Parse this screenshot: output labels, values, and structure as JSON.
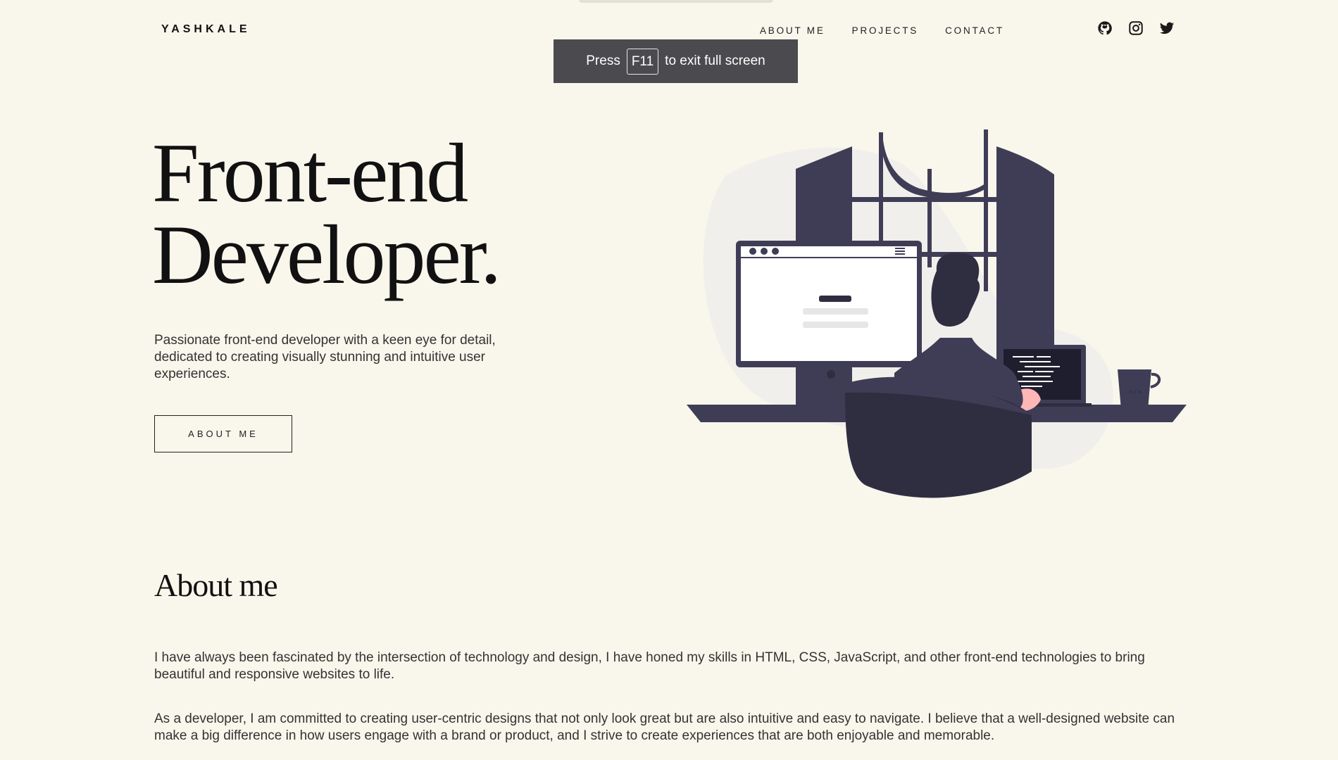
{
  "header": {
    "logo": "YASHKALE",
    "nav": [
      "ABOUT ME",
      "PROJECTS",
      "CONTACT"
    ],
    "socials": [
      "github-icon",
      "instagram-icon",
      "twitter-icon"
    ]
  },
  "fullscreen_toast": {
    "press": "Press",
    "key": "F11",
    "rest": "to exit full screen"
  },
  "hero": {
    "title_line1": "Front-end",
    "title_line2": "Developer.",
    "description": "Passionate front-end developer with a keen eye for detail, dedicated to creating visually stunning and intuitive user experiences.",
    "button": "ABOUT ME"
  },
  "about": {
    "title": "About me",
    "paragraph1": "I have always been fascinated by the intersection of technology and design, I have honed my skills in HTML, CSS, JavaScript, and other front-end technologies to bring beautiful and responsive websites to life.",
    "paragraph2": "As a developer, I am committed to creating user-centric designs that not only look great but are also intuitive and easy to navigate. I believe that a well-designed website can make a big difference in how users engage with a brand or product, and I strive to create experiences that are both enjoyable and memorable."
  },
  "colors": {
    "background": "#f9f6ec",
    "illustration_dark": "#3f3d56",
    "toast_bg": "#4b4b4f",
    "skin": "#ffb6b6"
  }
}
